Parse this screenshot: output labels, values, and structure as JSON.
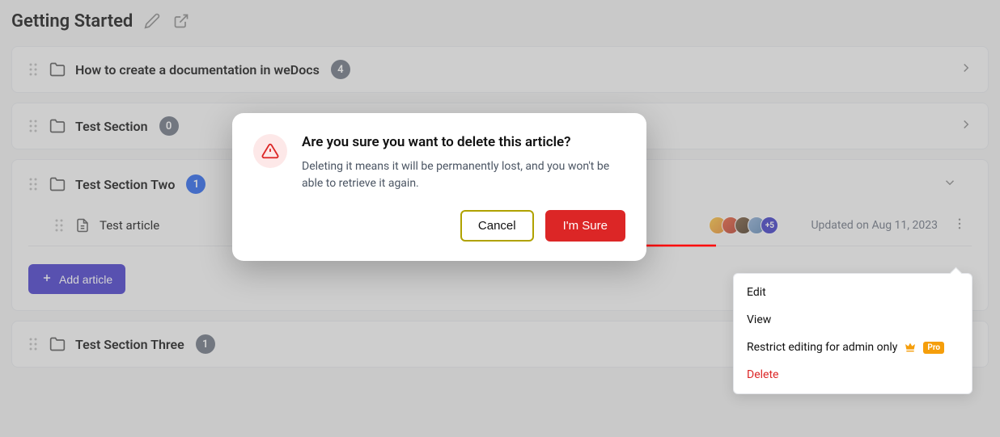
{
  "header": {
    "title": "Getting Started"
  },
  "sections": [
    {
      "title": "How to create a documentation in weDocs",
      "count": "4"
    },
    {
      "title": "Test Section",
      "count": "0"
    },
    {
      "title": "Test Section Two",
      "count": "1"
    },
    {
      "title": "Test Section Three",
      "count": "1"
    }
  ],
  "article": {
    "title": "Test article",
    "avatars_more": "+5",
    "updated": "Updated on Aug 11, 2023"
  },
  "add_article_label": "Add article",
  "dropdown": {
    "edit": "Edit",
    "view": "View",
    "restrict": "Restrict editing for admin only",
    "pro": "Pro",
    "delete": "Delete"
  },
  "modal": {
    "title": "Are you sure you want to delete this article?",
    "text": "Deleting it means it will be permanently lost, and you won't be able to retrieve it again.",
    "cancel": "Cancel",
    "confirm": "I'm Sure"
  }
}
